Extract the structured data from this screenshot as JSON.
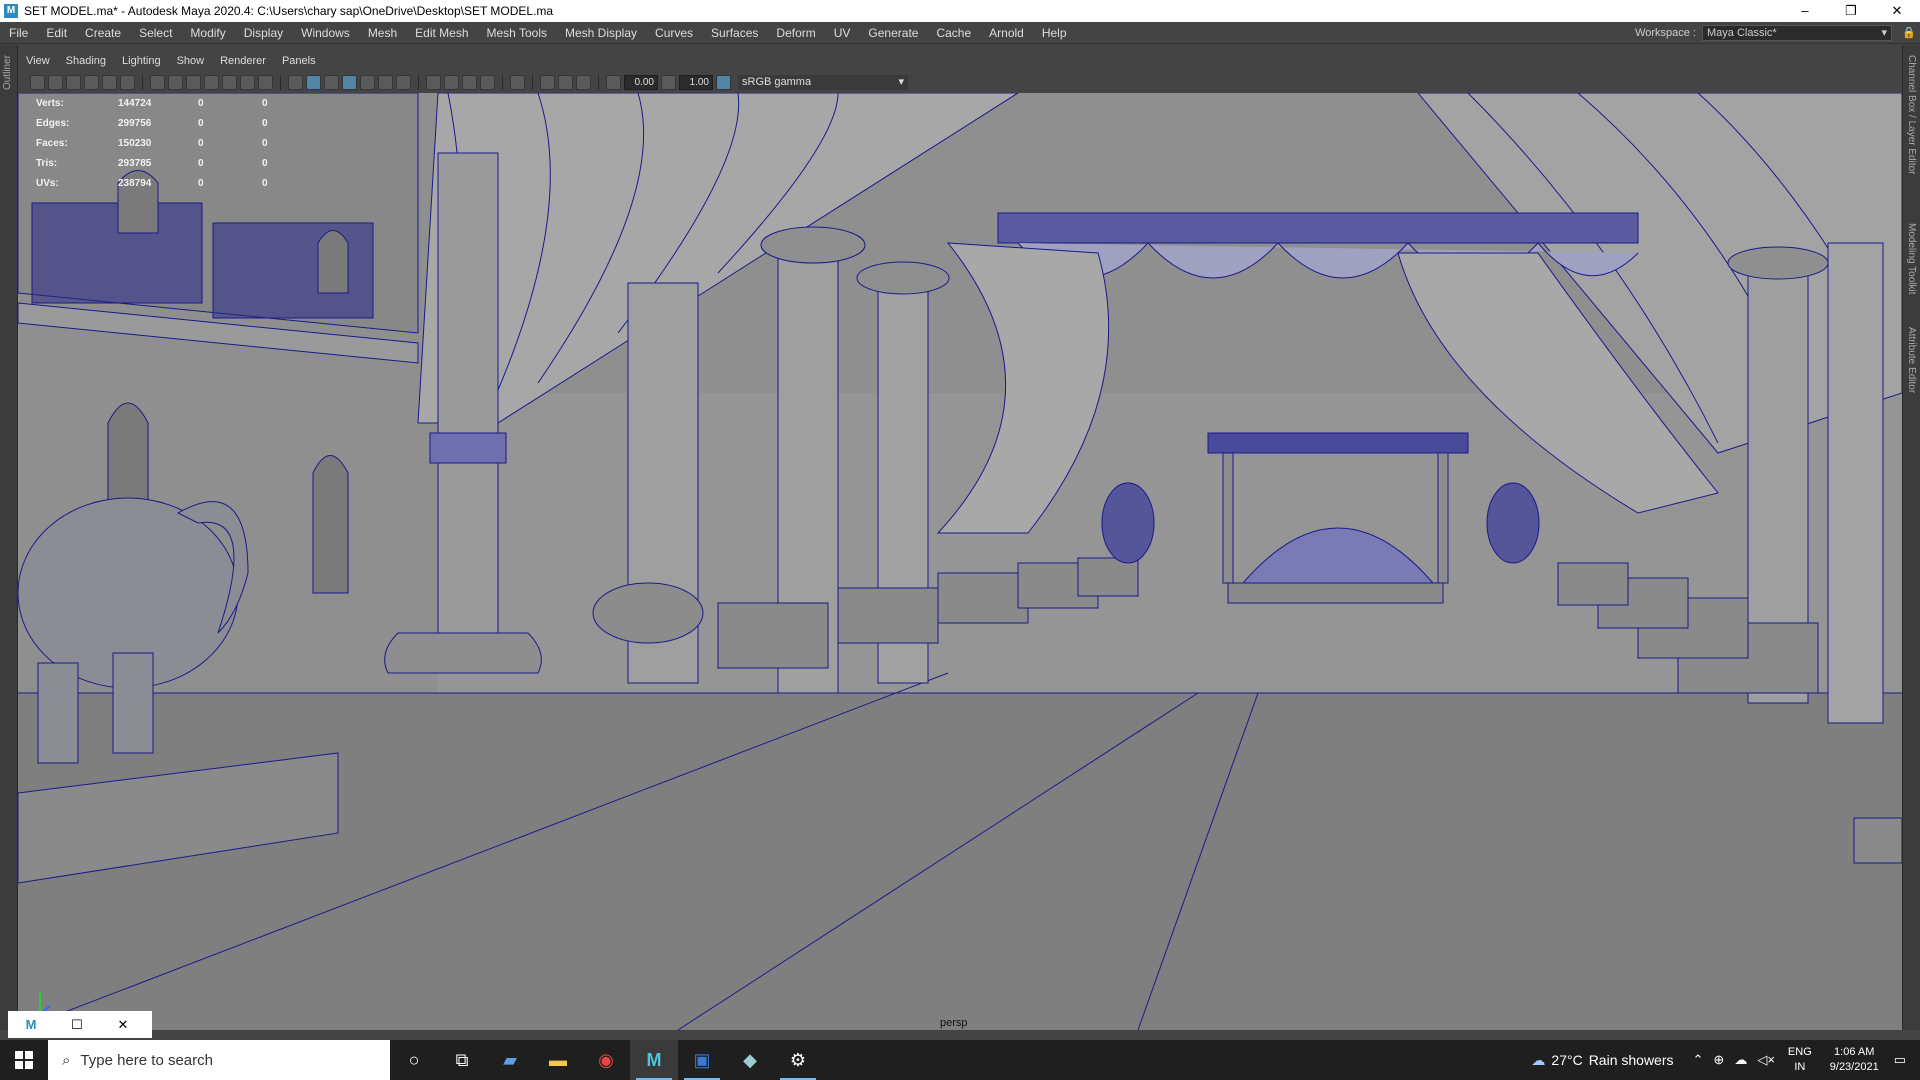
{
  "window": {
    "title": "SET MODEL.ma* - Autodesk Maya 2020.4: C:\\Users\\chary sap\\OneDrive\\Desktop\\SET MODEL.ma",
    "controls": [
      "–",
      "❐",
      "✕"
    ]
  },
  "menu": [
    "File",
    "Edit",
    "Create",
    "Select",
    "Modify",
    "Display",
    "Windows",
    "Mesh",
    "Edit Mesh",
    "Mesh Tools",
    "Mesh Display",
    "Curves",
    "Surfaces",
    "Deform",
    "UV",
    "Generate",
    "Cache",
    "Arnold",
    "Help"
  ],
  "workspace": {
    "label": "Workspace :",
    "value": "Maya Classic*"
  },
  "side_labels": {
    "left": "Outliner",
    "right": [
      "Channel Box / Layer Editor",
      "Modeling Toolkit",
      "Attribute Editor"
    ]
  },
  "panel_menu": [
    "View",
    "Shading",
    "Lighting",
    "Show",
    "Renderer",
    "Panels"
  ],
  "panel_toolbar": {
    "exposure": "0.00",
    "gamma": "1.00",
    "color_space": "sRGB gamma"
  },
  "hud": {
    "rows": [
      {
        "label": "Verts:",
        "v1": "144724",
        "v2": "0",
        "v3": "0"
      },
      {
        "label": "Edges:",
        "v1": "299756",
        "v2": "0",
        "v3": "0"
      },
      {
        "label": "Faces:",
        "v1": "150230",
        "v2": "0",
        "v3": "0"
      },
      {
        "label": "Tris:",
        "v1": "293785",
        "v2": "0",
        "v3": "0"
      },
      {
        "label": "UVs:",
        "v1": "238794",
        "v2": "0",
        "v3": "0"
      }
    ]
  },
  "camera": "persp",
  "wire_color": "#1a1a8c",
  "taskbar": {
    "search_placeholder": "Type here to search",
    "weather": {
      "temp": "27°C",
      "desc": "Rain showers"
    },
    "lang": [
      "ENG",
      "IN"
    ],
    "time": "1:06 AM",
    "date": "9/23/2021"
  }
}
